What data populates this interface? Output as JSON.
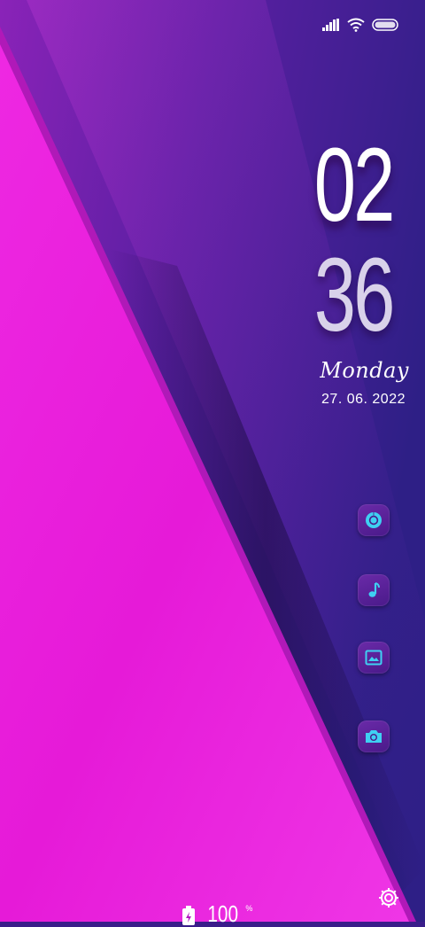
{
  "lockscreen": {
    "hour": "02",
    "minute": "36",
    "weekday": "Monday",
    "date": "27. 06. 2022"
  },
  "shortcuts": [
    {
      "name": "chrome-icon"
    },
    {
      "name": "music-note-icon"
    },
    {
      "name": "gallery-icon"
    },
    {
      "name": "camera-icon"
    }
  ],
  "battery": {
    "level": "100",
    "unit": "%"
  },
  "colors": {
    "magenta": "#e620d8",
    "purple": "#5a20a8",
    "indigo": "#3a1d8a",
    "icon_accent": "#3fd0f2"
  }
}
